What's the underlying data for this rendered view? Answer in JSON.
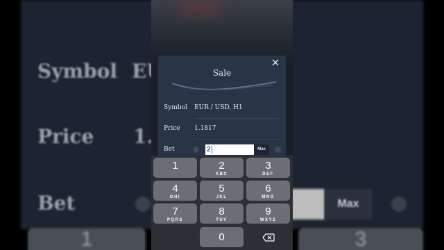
{
  "background": {
    "labels": [
      "Symbol",
      "Price",
      "Bet"
    ],
    "symbol_partial": "EU",
    "price_partial": "1.",
    "max_label": "Max",
    "key_partial_left": "1",
    "key_partial_right": "3"
  },
  "dialog": {
    "title": "Sale",
    "close_icon": "close-icon",
    "rows": [
      {
        "label": "Symbol",
        "value": "EUR / USD, H1"
      },
      {
        "label": "Price",
        "value": "1.1817"
      }
    ],
    "bet": {
      "label": "Bet",
      "value": "2",
      "max_label": "Max",
      "left_arrow": "‹",
      "right_arrow": "›"
    }
  },
  "keypad": {
    "keys": [
      {
        "num": "1",
        "letters": ""
      },
      {
        "num": "2",
        "letters": "ABC"
      },
      {
        "num": "3",
        "letters": "DEF"
      },
      {
        "num": "4",
        "letters": "GHI"
      },
      {
        "num": "5",
        "letters": "JKL"
      },
      {
        "num": "6",
        "letters": "MNO"
      },
      {
        "num": "7",
        "letters": "PQRS"
      },
      {
        "num": "8",
        "letters": "TUV"
      },
      {
        "num": "9",
        "letters": "WXYZ"
      },
      {
        "num": "0",
        "letters": ""
      }
    ],
    "backspace_icon": "backspace-icon"
  },
  "colors": {
    "dialog_bg": "#2a3447",
    "keypad_bg": "#2c2f34",
    "key_bg": "#6b6e73",
    "caret": "#1a73e8"
  }
}
